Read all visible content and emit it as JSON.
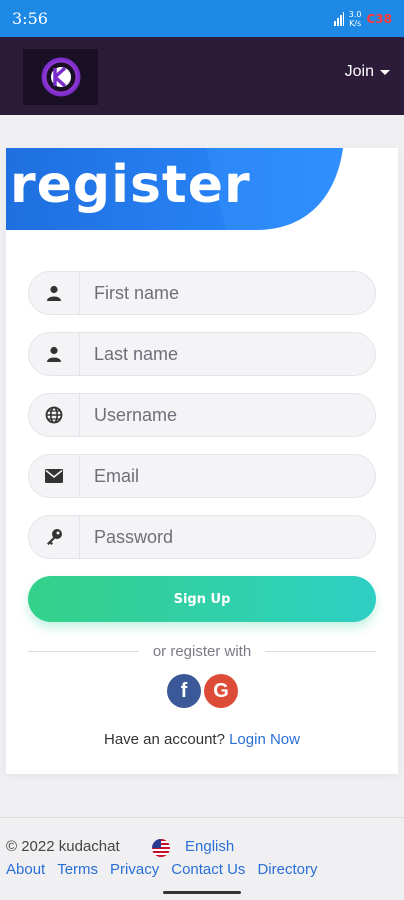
{
  "status_bar": {
    "time": "3:56",
    "network_speed_top": "3.0",
    "network_speed_bottom": "K/s",
    "battery": "C38"
  },
  "header": {
    "logo_icon": "kudachat-logo-icon",
    "join_label": "Join"
  },
  "register": {
    "banner_title": "register",
    "fields": [
      {
        "icon": "user-icon",
        "placeholder": "First name",
        "value": ""
      },
      {
        "icon": "user-icon",
        "placeholder": "Last name",
        "value": ""
      },
      {
        "icon": "globe-icon",
        "placeholder": "Username",
        "value": ""
      },
      {
        "icon": "envelope-icon",
        "placeholder": "Email",
        "value": ""
      },
      {
        "icon": "key-icon",
        "placeholder": "Password",
        "value": ""
      }
    ],
    "signup_label": "Sign Up",
    "divider_text": "or register with",
    "social": {
      "facebook": "f",
      "google": "G"
    },
    "have_account_text": "Have an account?",
    "login_link": "Login Now"
  },
  "footer": {
    "copyright": "© 2022 kudachat",
    "language": "English",
    "links": [
      "About",
      "Terms",
      "Privacy",
      "Contact Us",
      "Directory"
    ]
  },
  "colors": {
    "status_bar": "#1e88e5",
    "header": "#2c1c3a",
    "banner_start": "#1f6fe0",
    "banner_end": "#2b8cff",
    "signup_start": "#34d18a",
    "signup_end": "#2ecfc4",
    "link": "#2a6fd6"
  }
}
